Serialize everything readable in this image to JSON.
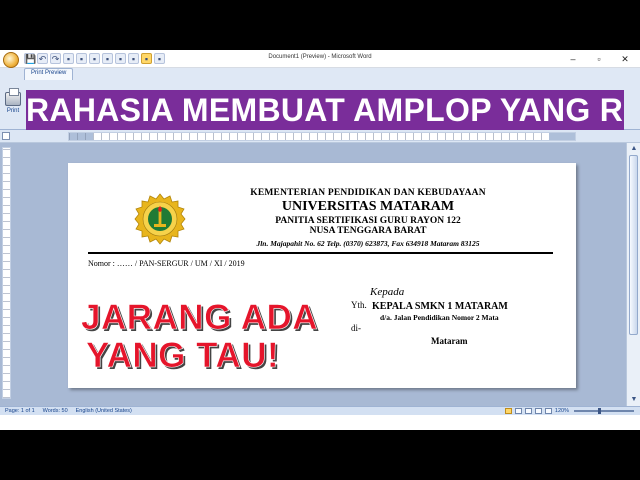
{
  "window": {
    "title": "Document1 (Preview) - Microsoft Word",
    "minimize": "–",
    "restore": "▫",
    "close": "✕"
  },
  "qat": [
    "💾",
    "↶",
    "↷",
    "▪",
    "▪",
    "▪",
    "▪",
    "▪",
    "▪",
    "▪",
    "▪"
  ],
  "ribbon": {
    "tab": "Print Preview",
    "print_label": "Print"
  },
  "banner_text": "RAHASIA MEMBUAT AMPLOP YANG RAPI",
  "letterhead": {
    "line1": "KEMENTERIAN PENDIDIKAN DAN KEBUDAYAAN",
    "line2": "UNIVERSITAS MATARAM",
    "line3": "PANITIA SERTIFIKASI GURU RAYON 122",
    "line4": "NUSA TENGGARA BARAT",
    "address": "Jln. Majapahit No. 62 Telp. (0370) 623873, Fax 634918 Mataram 83125"
  },
  "nomor": "Nomor : …… / PAN-SERGUR / UM / XI / 2019",
  "overlay": {
    "line1": "JARANG ADA",
    "line2": "YANG TAU!"
  },
  "recipient": {
    "kepada": "Kepada",
    "yth": "Yth.",
    "name": "KEPALA SMKN 1 MATARAM",
    "address": "d/a. Jalan Pendidikan Nomor 2 Mata",
    "di": "di-",
    "city": "Mataram"
  },
  "status": {
    "page": "Page: 1 of 1",
    "words": "Words: 50",
    "language": "English (United States)",
    "zoom": "120%"
  },
  "colors": {
    "banner_bg": "#7a2d9a",
    "overlay_text": "#e5152b",
    "ribbon_bg": "#dfe8f5",
    "workspace_bg": "#a8b9d4"
  },
  "icons": {
    "office_button": "office-logo-icon",
    "print": "printer-icon",
    "university_logo": "university-seal-icon"
  }
}
